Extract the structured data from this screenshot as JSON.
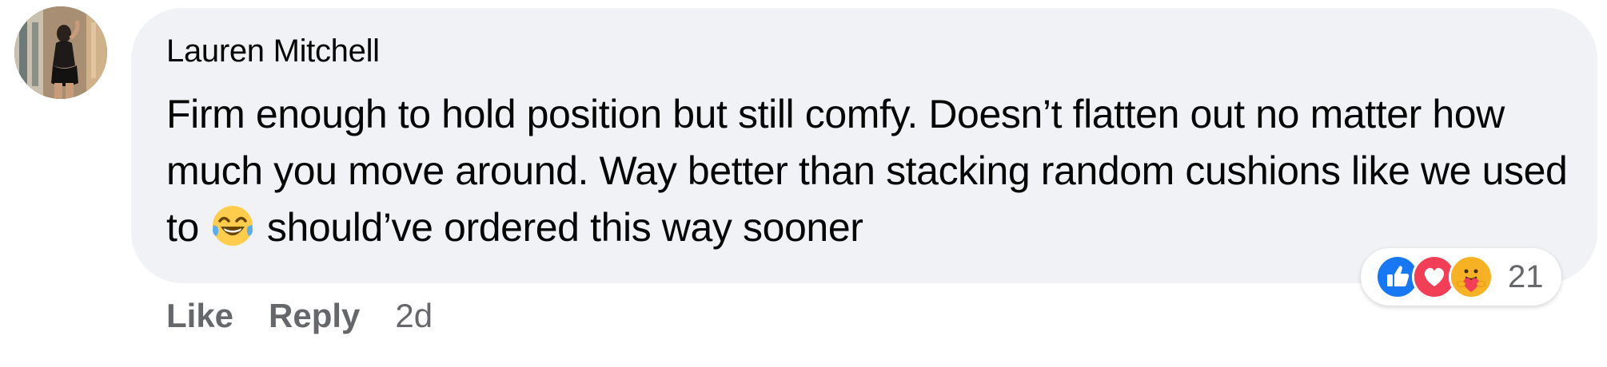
{
  "comment": {
    "author": "Lauren Mitchell",
    "text_part1": "Firm enough to hold position but still comfy. Doesn’t flatten out no matter how much you move around. Way better than stacking random cushions like we used to",
    "emoji": "face-with-tears-of-joy",
    "text_part2": "should’ve ordered this way sooner",
    "avatar": "user-avatar-photo"
  },
  "reactions": {
    "icons": [
      "like-icon",
      "love-icon",
      "care-icon"
    ],
    "count": "21",
    "colors": {
      "like": "#1877f2",
      "love": "#f33e58",
      "care": "#f7b125"
    }
  },
  "actions": {
    "like_label": "Like",
    "reply_label": "Reply",
    "timestamp": "2d"
  },
  "colors": {
    "bubble_bg": "#f0f2f5",
    "text": "#050505",
    "secondary_text": "#65676b"
  }
}
